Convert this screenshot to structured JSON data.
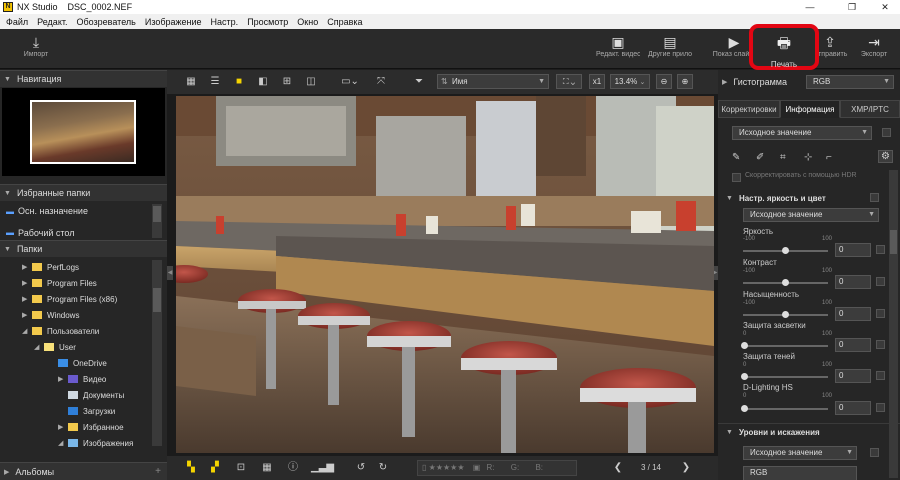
{
  "window": {
    "app_name": "NX Studio",
    "file_name": "DSC_0002.NEF",
    "minimize": "—",
    "maximize": "❐",
    "close": "✕"
  },
  "menu": [
    "Файл",
    "Редакт.",
    "Обозреватель",
    "Изображение",
    "Настр.",
    "Просмотр",
    "Окно",
    "Справка"
  ],
  "toolbar": {
    "import": "Импорт",
    "edit_video": "Редакт. видео",
    "other_apps": "Другие приложения",
    "slideshow": "Показ слайд.",
    "print": "Печать",
    "send": "Отправить",
    "export": "Экспорт"
  },
  "left_panel": {
    "navigation": "Навигация",
    "favorites": "Избранные папки",
    "fav_items": [
      "Осн. назначение",
      "Рабочий стол"
    ],
    "folders": "Папки",
    "tree": [
      "PerfLogs",
      "Program Files",
      "Program Files (x86)",
      "Windows",
      "Пользователи",
      "User",
      "OneDrive",
      "Видео",
      "Документы",
      "Загрузки",
      "Избранное",
      "Изображения"
    ],
    "albums": "Альбомы"
  },
  "viewer": {
    "sort_label": "Имя",
    "zoom_x": "x1",
    "zoom_percent": "13.4%",
    "rgb_labels": {
      "r": "R:",
      "g": "G:",
      "b": "B:"
    },
    "page": "3 / 14"
  },
  "right_panel": {
    "histogram": "Гистограмма",
    "histogram_channel": "RGB",
    "tabs": [
      "Корректировки",
      "Информация",
      "XMP/IPTC"
    ],
    "preset": "Исходное значение",
    "hdr_label": "Скорректировать с помощью HDR",
    "section_brightness": "Настр. яркость и цвет",
    "brightness_preset": "Исходное значение",
    "sliders": [
      {
        "label": "Яркость",
        "min": "-100",
        "max": "100",
        "value": "0"
      },
      {
        "label": "Контраст",
        "min": "-100",
        "max": "100",
        "value": "0"
      },
      {
        "label": "Насыщенность",
        "min": "-100",
        "max": "100",
        "value": "0"
      },
      {
        "label": "Защита засветки",
        "min": "0",
        "max": "100",
        "value": "0"
      },
      {
        "label": "Защита теней",
        "min": "0",
        "max": "100",
        "value": "0"
      },
      {
        "label": "D-Lighting HS",
        "min": "0",
        "max": "100",
        "value": "0"
      }
    ],
    "section_levels": "Уровни и искажения",
    "levels_preset": "Исходное значение",
    "levels_channel": "RGB"
  }
}
